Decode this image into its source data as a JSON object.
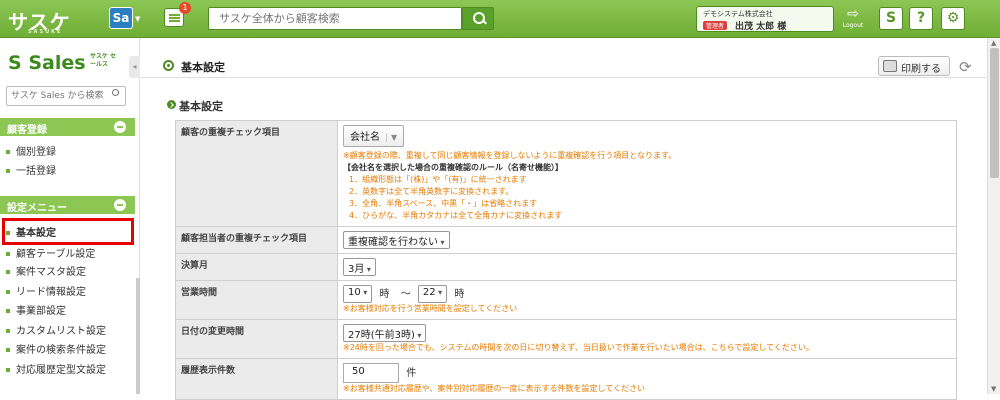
{
  "app": {
    "logo": "サスケ",
    "logo_sub": "SASUKE",
    "sa_label": "Sa",
    "message_badge": "1",
    "search_placeholder": "サスケ全体から顧客検索",
    "company": "デモシステム株式会社",
    "role": "管理者",
    "user": "出茂 太郎 様",
    "logout_label": "Logout",
    "help_label": "?",
    "s_label": "S"
  },
  "sidebar": {
    "brand": "Sales",
    "brand_sub": "サスケ セールス",
    "search_placeholder": "サスケ Sales から検索",
    "sections": [
      {
        "title": "顧客登録",
        "items": [
          "個別登録",
          "一括登録"
        ]
      },
      {
        "title": "設定メニュー",
        "items": [
          "基本設定",
          "顧客テーブル設定",
          "案件マスタ設定",
          "リード情報設定",
          "事業部設定",
          "カスタムリスト設定",
          "案件の検索条件設定",
          "対応履歴定型文設定"
        ]
      }
    ]
  },
  "main": {
    "page_title": "基本設定",
    "print_label": "印刷する",
    "section_title": "基本設定",
    "rows": {
      "dup": {
        "label": "顧客の重複チェック項目",
        "value": "会社名",
        "note": "※顧客登録の際、重複して同じ顧客情報を登録しないように重複確認を行う項目となります。",
        "rule_head": "【会社名を選択した場合の重複確認のルール（名寄せ機能）】",
        "rules": [
          "1．組織形態は「(株)」や「(有)」に統一されます",
          "2．英数字は全て半角英数字に変換されます。",
          "3．全角、半角スペース、中黒「・」は省略されます",
          "4．ひらがな、半角カタカナは全て全角カナに変換されます"
        ]
      },
      "owner_dup": {
        "label": "顧客担当者の重複チェック項目",
        "value": "重複確認を行わない"
      },
      "fiscal": {
        "label": "決算月",
        "value": "3月"
      },
      "hours": {
        "label": "営業時間",
        "start": "10",
        "end": "22",
        "hour_unit": "時",
        "tilde": "〜",
        "note": "※お客様対応を行う営業時間を設定してください"
      },
      "date_change": {
        "label": "日付の変更時間",
        "value": "27時(午前3時)",
        "note": "※24時を回った場合でも、システムの時間を次の日に切り替えず、当日扱いで作業を行いたい場合は、こちらで設定してください。"
      },
      "history": {
        "label": "履歴表示件数",
        "value": "50",
        "unit": "件",
        "note": "※お客様共通対応履歴や、案件別対応履歴の一度に表示する件数を設定してください"
      }
    }
  }
}
